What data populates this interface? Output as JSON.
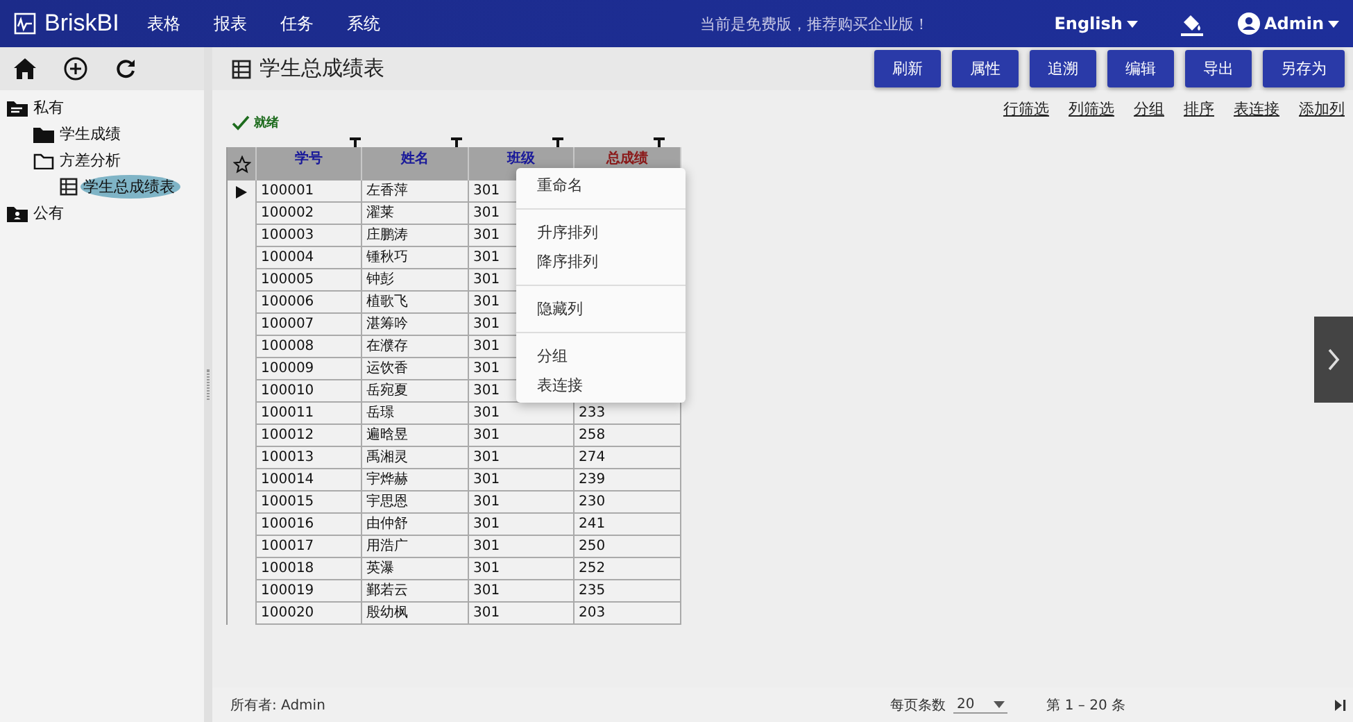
{
  "app": {
    "logo": "BriskBI",
    "nav": [
      "表格",
      "报表",
      "任务",
      "系统"
    ],
    "notice": "当前是免费版，推荐购买企业版！",
    "language": "English",
    "user": "Admin"
  },
  "sidebar": {
    "tree": [
      {
        "label": "私有",
        "kind": "private",
        "selected": false,
        "children": [
          {
            "label": "学生成绩",
            "kind": "folder",
            "expanded": false,
            "selected": false
          },
          {
            "label": "方差分析",
            "kind": "folder",
            "expanded": true,
            "selected": false,
            "children": [
              {
                "label": "学生总成绩表",
                "kind": "table",
                "selected": true
              }
            ]
          }
        ]
      },
      {
        "label": "公有",
        "kind": "public",
        "selected": false
      }
    ]
  },
  "page": {
    "title": "学生总成绩表",
    "buttons": [
      "刷新",
      "属性",
      "追溯",
      "编辑",
      "导出",
      "另存为"
    ],
    "links": [
      "行筛选",
      "列筛选",
      "分组",
      "排序",
      "表连接",
      "添加列"
    ],
    "status": "就绪"
  },
  "table": {
    "columns": [
      {
        "label": "学号",
        "color": "#1a1a9a"
      },
      {
        "label": "姓名",
        "color": "#1a1a9a"
      },
      {
        "label": "班级",
        "color": "#1a1a9a"
      },
      {
        "label": "总成绩",
        "color": "#8b1a1a"
      }
    ],
    "rows": [
      {
        "current": true,
        "cells": [
          "100001",
          "左香萍",
          "301"
        ]
      },
      {
        "current": false,
        "cells": [
          "100002",
          "濯莱",
          "301"
        ]
      },
      {
        "current": false,
        "cells": [
          "100003",
          "庄鹏涛",
          "301"
        ]
      },
      {
        "current": false,
        "cells": [
          "100004",
          "锺秋巧",
          "301"
        ]
      },
      {
        "current": false,
        "cells": [
          "100005",
          "钟彭",
          "301"
        ]
      },
      {
        "current": false,
        "cells": [
          "100006",
          "植歌飞",
          "301"
        ]
      },
      {
        "current": false,
        "cells": [
          "100007",
          "湛筹吟",
          "301"
        ]
      },
      {
        "current": false,
        "cells": [
          "100008",
          "在濮存",
          "301"
        ]
      },
      {
        "current": false,
        "cells": [
          "100009",
          "运饮香",
          "301"
        ]
      },
      {
        "current": false,
        "cells": [
          "100010",
          "岳宛夏",
          "301"
        ]
      },
      {
        "current": false,
        "cells": [
          "100011",
          "岳璟",
          "301",
          "233"
        ]
      },
      {
        "current": false,
        "cells": [
          "100012",
          "遍晗昱",
          "301",
          "258"
        ]
      },
      {
        "current": false,
        "cells": [
          "100013",
          "禹湘灵",
          "301",
          "274"
        ]
      },
      {
        "current": false,
        "cells": [
          "100014",
          "宇烨赫",
          "301",
          "239"
        ]
      },
      {
        "current": false,
        "cells": [
          "100015",
          "宇思恩",
          "301",
          "230"
        ]
      },
      {
        "current": false,
        "cells": [
          "100016",
          "由仲舒",
          "301",
          "241"
        ]
      },
      {
        "current": false,
        "cells": [
          "100017",
          "用浩广",
          "301",
          "250"
        ]
      },
      {
        "current": false,
        "cells": [
          "100018",
          "英瀑",
          "301",
          "252"
        ]
      },
      {
        "current": false,
        "cells": [
          "100019",
          "鄞若云",
          "301",
          "235"
        ]
      },
      {
        "current": false,
        "cells": [
          "100020",
          "殷幼枫",
          "301",
          "203"
        ]
      }
    ]
  },
  "context_menu": {
    "groups": [
      [
        "重命名"
      ],
      [
        "升序排列",
        "降序排列"
      ],
      [
        "隐藏列"
      ],
      [
        "分组",
        "表连接"
      ]
    ]
  },
  "footer": {
    "owner": "所有者: Admin",
    "page_size_label": "每页条数",
    "page_size": "20",
    "range": "第 1 – 20 条"
  }
}
